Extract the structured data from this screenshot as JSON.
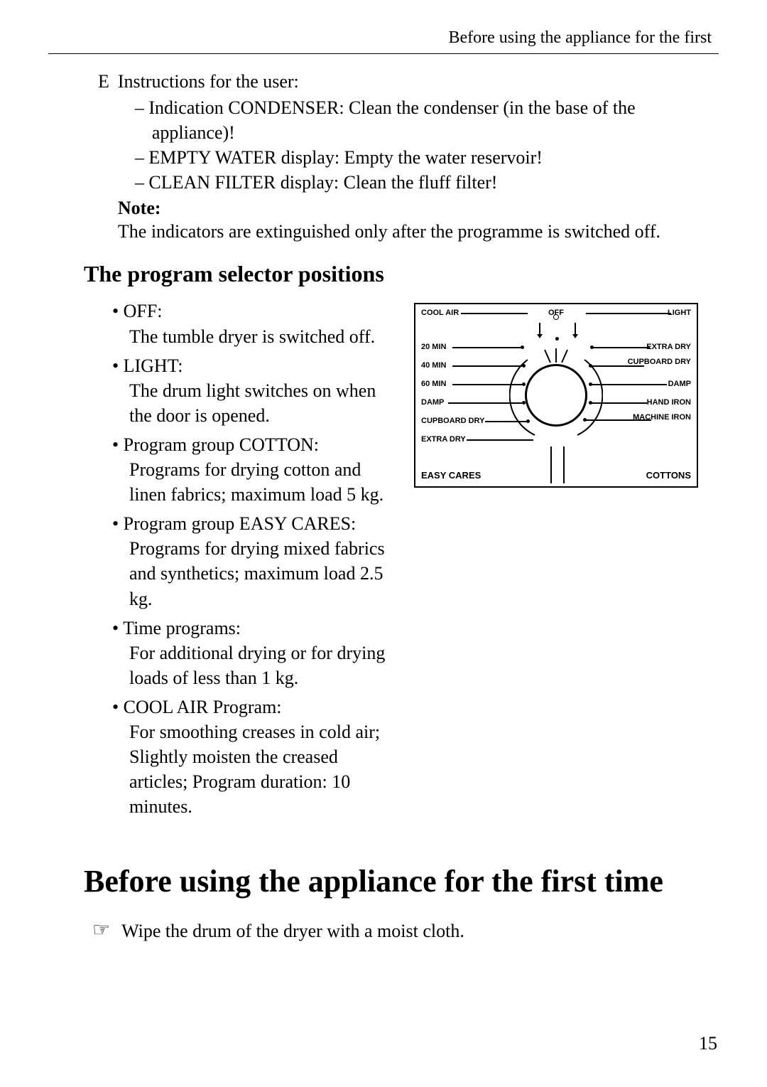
{
  "header": {
    "running_title": "Before using the appliance for the first"
  },
  "section_e": {
    "marker": "E",
    "title": "Instructions for the user:",
    "items": [
      "Indication CONDENSER: Clean the condenser (in the base of the appliance)!",
      "EMPTY WATER display: Empty the water reservoir!",
      "CLEAN FILTER display: Clean the fluff filter!"
    ],
    "note_label": "Note:",
    "note_text": "The indicators are extinguished only after the programme is switched off."
  },
  "program_selector": {
    "heading": "The program selector positions",
    "items": [
      {
        "head": "OFF:",
        "body": "The tumble dryer is switched off."
      },
      {
        "head": "LIGHT:",
        "body": "The drum light switches on when the door is opened."
      },
      {
        "head": "Program group COTTON:",
        "body": "Programs for drying cotton and linen fabrics;\nmaximum load 5 kg."
      },
      {
        "head": "Program group EASY CARES:",
        "body": "Programs for drying mixed fabrics and synthetics;\nmaximum load 2.5 kg."
      },
      {
        "head": "Time programs:",
        "body": "For additional drying or for drying loads of less than 1 kg."
      },
      {
        "head": "COOL AIR Program:",
        "body": "For smoothing creases in cold air; Slightly moisten the creased articles;\nProgram duration: 10 minutes."
      }
    ]
  },
  "dial": {
    "top_left": "COOL AIR",
    "top_center": "OFF",
    "top_right": "LIGHT",
    "left": [
      "20 MIN",
      "40 MIN",
      "60 MIN",
      "DAMP",
      "CUPBOARD DRY",
      "EXTRA DRY"
    ],
    "bottom_left": "EASY CARES",
    "right": [
      "EXTRA DRY",
      "CUPBOARD DRY",
      "DAMP",
      "HAND IRON",
      "MACHINE IRON"
    ],
    "bottom_right": "COTTONS"
  },
  "first_use": {
    "heading": "Before using the appliance for the first time",
    "step": "Wipe the drum of the dryer with a moist cloth."
  },
  "page_number": "15"
}
